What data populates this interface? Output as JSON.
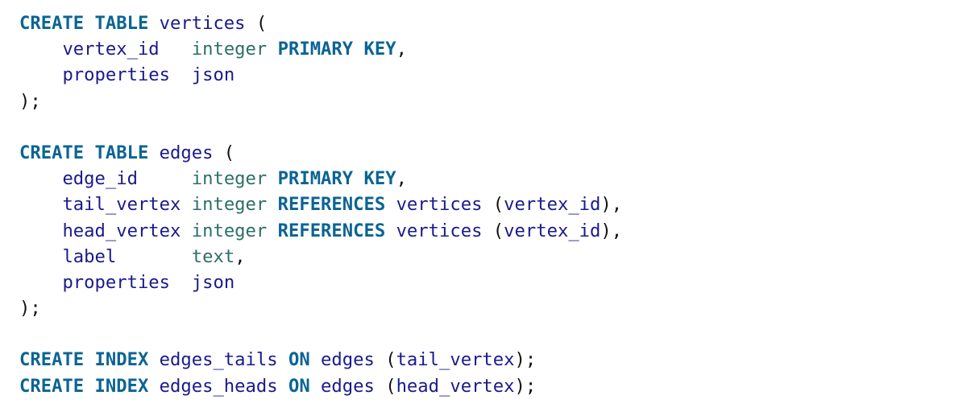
{
  "document": {
    "language": "SQL",
    "colors": {
      "keyword": "#0b6494",
      "identifier": "#1a1a8c",
      "type": "#2c6e6a",
      "punctuation": "#111111",
      "background": "#ffffff"
    },
    "lines": [
      [
        {
          "t": "kw",
          "v": "CREATE TABLE"
        },
        {
          "t": "pu",
          "v": " "
        },
        {
          "t": "id",
          "v": "vertices"
        },
        {
          "t": "pu",
          "v": " ("
        }
      ],
      [
        {
          "t": "pu",
          "v": "    "
        },
        {
          "t": "id",
          "v": "vertex_id"
        },
        {
          "t": "pu",
          "v": "   "
        },
        {
          "t": "ty",
          "v": "integer"
        },
        {
          "t": "pu",
          "v": " "
        },
        {
          "t": "kw",
          "v": "PRIMARY KEY"
        },
        {
          "t": "pu",
          "v": ","
        }
      ],
      [
        {
          "t": "pu",
          "v": "    "
        },
        {
          "t": "id",
          "v": "properties"
        },
        {
          "t": "pu",
          "v": "  "
        },
        {
          "t": "id",
          "v": "json"
        }
      ],
      [
        {
          "t": "pu",
          "v": ");"
        }
      ],
      [],
      [
        {
          "t": "kw",
          "v": "CREATE TABLE"
        },
        {
          "t": "pu",
          "v": " "
        },
        {
          "t": "id",
          "v": "edges"
        },
        {
          "t": "pu",
          "v": " ("
        }
      ],
      [
        {
          "t": "pu",
          "v": "    "
        },
        {
          "t": "id",
          "v": "edge_id"
        },
        {
          "t": "pu",
          "v": "     "
        },
        {
          "t": "ty",
          "v": "integer"
        },
        {
          "t": "pu",
          "v": " "
        },
        {
          "t": "kw",
          "v": "PRIMARY KEY"
        },
        {
          "t": "pu",
          "v": ","
        }
      ],
      [
        {
          "t": "pu",
          "v": "    "
        },
        {
          "t": "id",
          "v": "tail_vertex"
        },
        {
          "t": "pu",
          "v": " "
        },
        {
          "t": "ty",
          "v": "integer"
        },
        {
          "t": "pu",
          "v": " "
        },
        {
          "t": "kw",
          "v": "REFERENCES"
        },
        {
          "t": "pu",
          "v": " "
        },
        {
          "t": "id",
          "v": "vertices"
        },
        {
          "t": "pu",
          "v": " ("
        },
        {
          "t": "id",
          "v": "vertex_id"
        },
        {
          "t": "pu",
          "v": "),"
        }
      ],
      [
        {
          "t": "pu",
          "v": "    "
        },
        {
          "t": "id",
          "v": "head_vertex"
        },
        {
          "t": "pu",
          "v": " "
        },
        {
          "t": "ty",
          "v": "integer"
        },
        {
          "t": "pu",
          "v": " "
        },
        {
          "t": "kw",
          "v": "REFERENCES"
        },
        {
          "t": "pu",
          "v": " "
        },
        {
          "t": "id",
          "v": "vertices"
        },
        {
          "t": "pu",
          "v": " ("
        },
        {
          "t": "id",
          "v": "vertex_id"
        },
        {
          "t": "pu",
          "v": "),"
        }
      ],
      [
        {
          "t": "pu",
          "v": "    "
        },
        {
          "t": "id",
          "v": "label"
        },
        {
          "t": "pu",
          "v": "       "
        },
        {
          "t": "ty",
          "v": "text"
        },
        {
          "t": "pu",
          "v": ","
        }
      ],
      [
        {
          "t": "pu",
          "v": "    "
        },
        {
          "t": "id",
          "v": "properties"
        },
        {
          "t": "pu",
          "v": "  "
        },
        {
          "t": "id",
          "v": "json"
        }
      ],
      [
        {
          "t": "pu",
          "v": ");"
        }
      ],
      [],
      [
        {
          "t": "kw",
          "v": "CREATE INDEX"
        },
        {
          "t": "pu",
          "v": " "
        },
        {
          "t": "id",
          "v": "edges_tails"
        },
        {
          "t": "pu",
          "v": " "
        },
        {
          "t": "kw",
          "v": "ON"
        },
        {
          "t": "pu",
          "v": " "
        },
        {
          "t": "id",
          "v": "edges"
        },
        {
          "t": "pu",
          "v": " ("
        },
        {
          "t": "id",
          "v": "tail_vertex"
        },
        {
          "t": "pu",
          "v": ");"
        }
      ],
      [
        {
          "t": "kw",
          "v": "CREATE INDEX"
        },
        {
          "t": "pu",
          "v": " "
        },
        {
          "t": "id",
          "v": "edges_heads"
        },
        {
          "t": "pu",
          "v": " "
        },
        {
          "t": "kw",
          "v": "ON"
        },
        {
          "t": "pu",
          "v": " "
        },
        {
          "t": "id",
          "v": "edges"
        },
        {
          "t": "pu",
          "v": " ("
        },
        {
          "t": "id",
          "v": "head_vertex"
        },
        {
          "t": "pu",
          "v": ");"
        }
      ]
    ]
  }
}
